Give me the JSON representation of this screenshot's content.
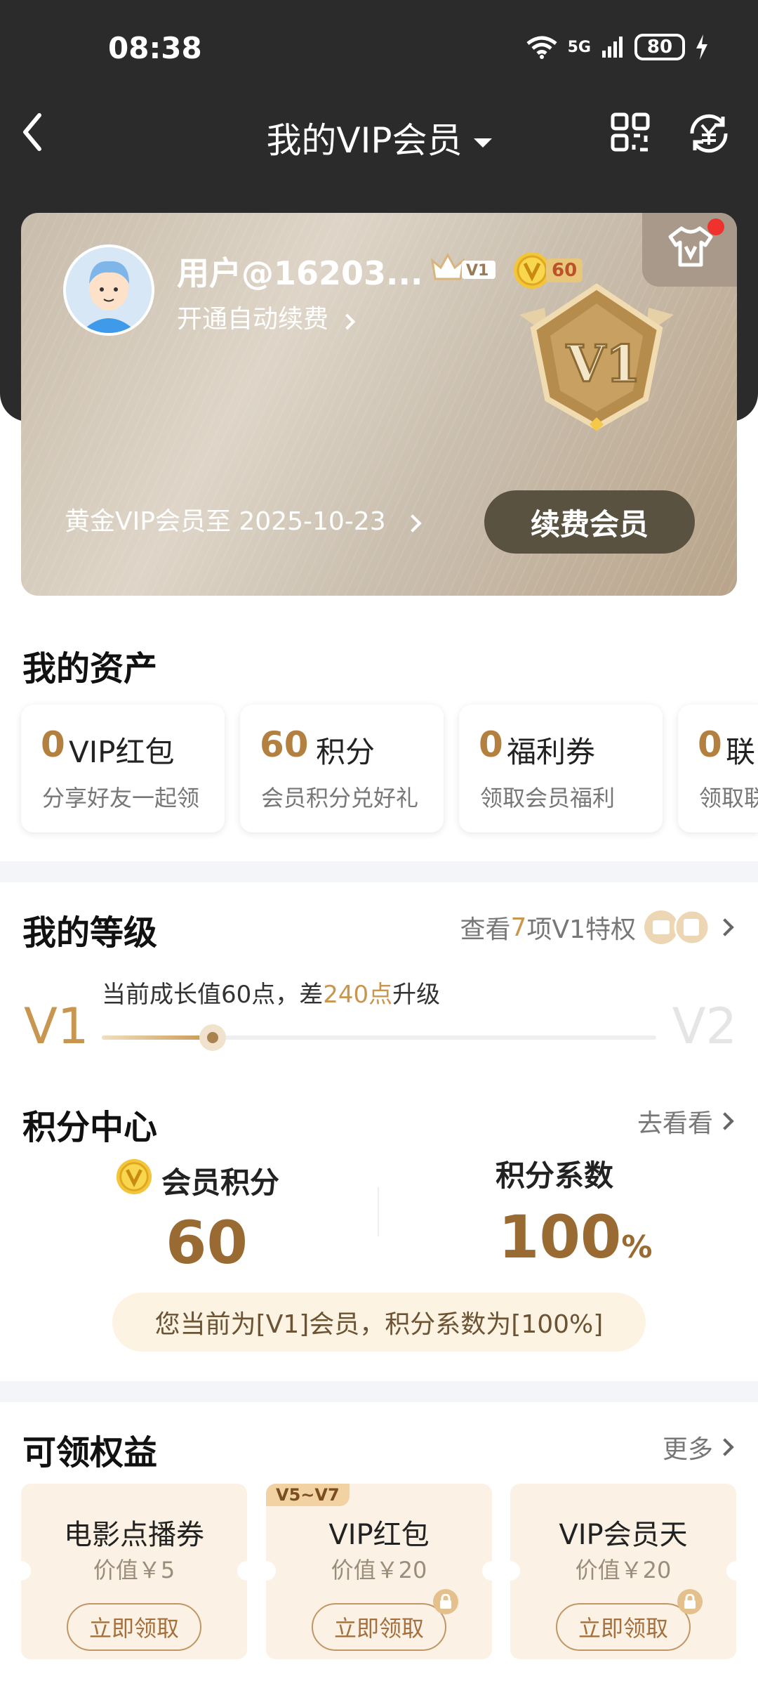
{
  "status_bar": {
    "time": "08:38",
    "network": "5G",
    "battery": "80"
  },
  "header": {
    "title": "我的VIP会员"
  },
  "vip_card": {
    "username": "用户@16203...",
    "level_badge": "V1",
    "coin_badge": "60",
    "auto_renew": "开通自动续费",
    "emblem_label": "V1",
    "expiry": "黄金VIP会员至 2025-10-23",
    "renew_button": "续费会员"
  },
  "assets": {
    "title": "我的资产",
    "items": [
      {
        "value": "0",
        "label": "VIP红包",
        "sub": "分享好友一起领"
      },
      {
        "value": "60",
        "label": "积分",
        "sub": "会员积分兑好礼"
      },
      {
        "value": "0",
        "label": "福利券",
        "sub": "领取会员福利"
      },
      {
        "value": "0",
        "label": "联",
        "sub": "领取联"
      }
    ]
  },
  "level": {
    "title": "我的等级",
    "link_prefix": "查看",
    "link_count": "7",
    "link_suffix": "项V1特权",
    "tip_prefix": "当前成长值60点，差",
    "tip_highlight": "240点",
    "tip_suffix": "升级",
    "current": "V1",
    "next": "V2",
    "progress": 0.2
  },
  "points": {
    "title": "积分中心",
    "link": "去看看",
    "member_points_label": "会员积分",
    "member_points_value": "60",
    "coef_label": "积分系数",
    "coef_value": "100",
    "coef_unit": "%",
    "banner": "您当前为[V1]会员，积分系数为[100%]"
  },
  "benefits": {
    "title": "可领权益",
    "link": "更多",
    "items": [
      {
        "name": "电影点播券",
        "value": "价值￥5",
        "button": "立即领取",
        "tag": ""
      },
      {
        "name": "VIP红包",
        "value": "价值￥20",
        "button": "立即领取",
        "tag": "V5~V7"
      },
      {
        "name": "VIP会员天",
        "value": "价值￥20",
        "button": "立即领取",
        "tag": ""
      }
    ]
  }
}
